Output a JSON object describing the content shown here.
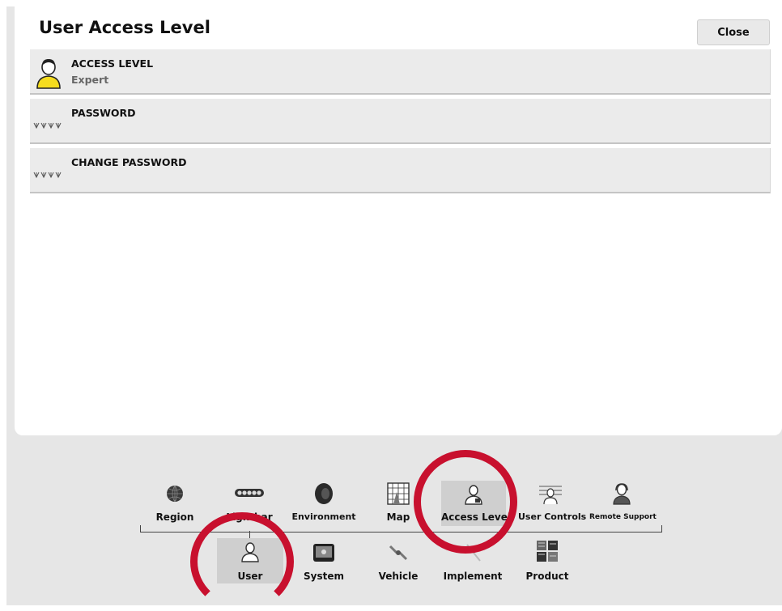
{
  "header": {
    "title": "User Access Level",
    "close_label": "Close"
  },
  "settings": [
    {
      "label": "ACCESS LEVEL",
      "value": "Expert",
      "icon": "user-avatar-icon"
    },
    {
      "label": "PASSWORD",
      "value": "",
      "icon": "password-dots-icon"
    },
    {
      "label": "CHANGE PASSWORD",
      "value": "",
      "icon": "password-dots-icon"
    }
  ],
  "nav_top": [
    {
      "label": "Region",
      "icon": "globe-icon"
    },
    {
      "label": "Lightbar",
      "icon": "lightbar-icon"
    },
    {
      "label": "Environment",
      "icon": "speaker-icon"
    },
    {
      "label": "Map",
      "icon": "map-grid-icon"
    },
    {
      "label": "Access Level",
      "icon": "user-lock-icon",
      "selected": true
    },
    {
      "label": "User Controls",
      "icon": "user-controls-icon"
    },
    {
      "label": "Remote Support",
      "icon": "headset-user-icon"
    }
  ],
  "nav_bottom": [
    {
      "label": "User",
      "icon": "user-icon",
      "selected": true
    },
    {
      "label": "System",
      "icon": "display-gear-icon"
    },
    {
      "label": "Vehicle",
      "icon": "vehicle-link-icon"
    },
    {
      "label": "Implement",
      "icon": "implement-icon"
    },
    {
      "label": "Product",
      "icon": "product-tiles-icon"
    }
  ],
  "colors": {
    "highlight_circle": "#c8102e",
    "selected_bg": "#cfcfcf",
    "avatar_yellow": "#f5dc1e"
  }
}
